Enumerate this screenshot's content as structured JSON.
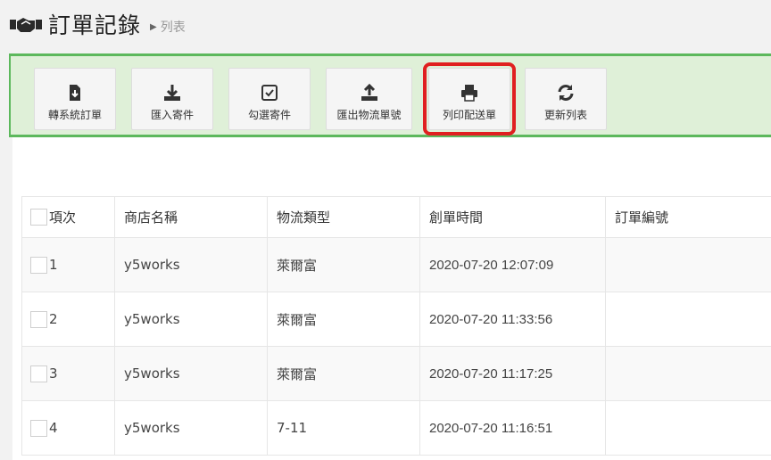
{
  "header": {
    "title": "訂單記錄",
    "breadcrumb": "列表"
  },
  "toolbar": {
    "buttons": [
      {
        "label": "轉系統訂單",
        "icon": "file-download-icon"
      },
      {
        "label": "匯入寄件",
        "icon": "download-icon"
      },
      {
        "label": "勾選寄件",
        "icon": "checkbox-icon"
      },
      {
        "label": "匯出物流單號",
        "icon": "upload-icon"
      },
      {
        "label": "列印配送單",
        "icon": "print-icon",
        "highlighted": true
      },
      {
        "label": "更新列表",
        "icon": "refresh-icon"
      }
    ]
  },
  "table": {
    "columns": [
      "項次",
      "商店名稱",
      "物流類型",
      "創單時間",
      "訂單編號"
    ],
    "rows": [
      {
        "index": "1",
        "store": "y5works",
        "logistics": "萊爾富",
        "created": "2020-07-20 12:07:09",
        "order_no": ""
      },
      {
        "index": "2",
        "store": "y5works",
        "logistics": "萊爾富",
        "created": "2020-07-20 11:33:56",
        "order_no": ""
      },
      {
        "index": "3",
        "store": "y5works",
        "logistics": "萊爾富",
        "created": "2020-07-20 11:17:25",
        "order_no": ""
      },
      {
        "index": "4",
        "store": "y5works",
        "logistics": "7-11",
        "created": "2020-07-20 11:16:51",
        "order_no": ""
      }
    ]
  },
  "colors": {
    "toolbar_bg": "#dff0d8",
    "toolbar_border": "#5cb85c",
    "highlight": "#e02020"
  }
}
